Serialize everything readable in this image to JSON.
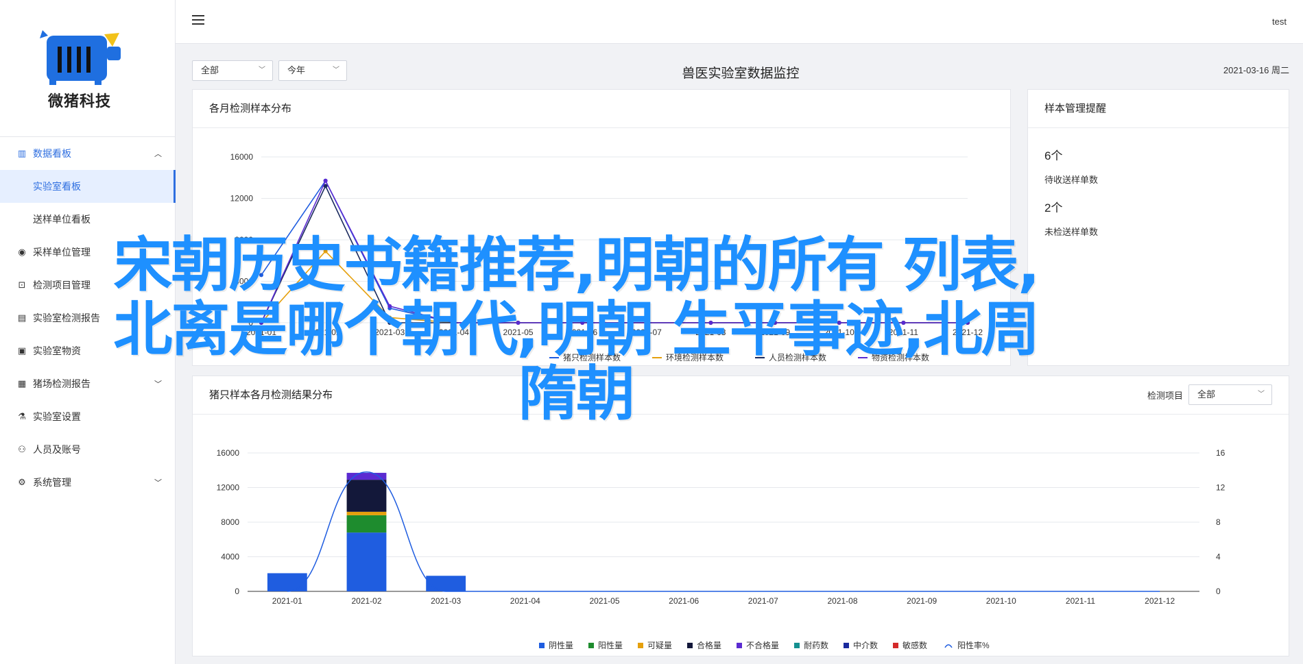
{
  "brand": {
    "name": "微猪科技"
  },
  "topbar": {
    "user": "test",
    "menu_icon": "hamburger-icon"
  },
  "sidebar": {
    "items": [
      {
        "label": "数据看板",
        "icon": "bar-chart-icon",
        "open": true,
        "children": [
          {
            "label": "实验室看板",
            "active": true
          },
          {
            "label": "送样单位看板",
            "active": false
          }
        ]
      },
      {
        "label": "采样单位管理",
        "icon": "eye-icon"
      },
      {
        "label": "检测项目管理",
        "icon": "lock-icon"
      },
      {
        "label": "实验室检测报告",
        "icon": "document-icon"
      },
      {
        "label": "实验室物资",
        "icon": "box-icon"
      },
      {
        "label": "猪场检测报告",
        "icon": "report-icon",
        "expandable": true
      },
      {
        "label": "实验室设置",
        "icon": "flask-icon"
      },
      {
        "label": "人员及账号",
        "icon": "user-icon"
      },
      {
        "label": "系统管理",
        "icon": "gear-icon",
        "expandable": true
      }
    ]
  },
  "filters": {
    "scope": "全部",
    "period": "今年"
  },
  "page": {
    "title": "兽医实验室数据监控",
    "date": "2021-03-16 周二"
  },
  "card_monthly": {
    "title": "各月检测样本分布"
  },
  "card_sample": {
    "title": "样本管理提醒",
    "stats": [
      {
        "value": "6个",
        "label": "待收送样单数"
      },
      {
        "value": "2个",
        "label": "未检送样单数"
      }
    ]
  },
  "card_pig": {
    "title": "猪只样本各月检测结果分布",
    "filter_label": "检测项目",
    "filter_value": "全部"
  },
  "overlay": {
    "lines": [
      "宋朝历史书籍推荐,明朝的所有 列表,",
      "北离是哪个朝代,明朝 生平事迹,北周",
      "隋朝"
    ]
  },
  "watermark": "",
  "chart_data": [
    {
      "type": "line",
      "title": "各月检测样本分布",
      "categories": [
        "2021-01",
        "2021-02",
        "2021-03",
        "2021-04",
        "2021-05",
        "2021-06",
        "2021-07",
        "2021-08",
        "2021-09",
        "2021-10",
        "2021-11",
        "2021-12"
      ],
      "ylim": [
        0,
        16000
      ],
      "yticks": [
        0,
        4000,
        8000,
        12000,
        16000
      ],
      "series": [
        {
          "name": "猪只检测样本数",
          "color": "#1f5de0",
          "values": [
            4600,
            13700,
            1400,
            0,
            0,
            0,
            0,
            0,
            0,
            0,
            0,
            0
          ]
        },
        {
          "name": "环境检测样本数",
          "color": "#e5a00d",
          "values": [
            0,
            6900,
            500,
            0,
            0,
            0,
            0,
            0,
            0,
            0,
            0,
            0
          ]
        },
        {
          "name": "人员检测样本数",
          "color": "#1a2a5e",
          "values": [
            0,
            13200,
            0,
            0,
            0,
            0,
            0,
            0,
            0,
            0,
            0,
            0
          ]
        },
        {
          "name": "物资检测样本数",
          "color": "#5b2bd1",
          "values": [
            0,
            13700,
            1600,
            0,
            0,
            0,
            0,
            0,
            0,
            0,
            0,
            0
          ]
        }
      ],
      "legend": "bottom"
    },
    {
      "type": "bar",
      "title": "猪只样本各月检测结果分布",
      "categories": [
        "2021-01",
        "2021-02",
        "2021-03",
        "2021-04",
        "2021-05",
        "2021-06",
        "2021-07",
        "2021-08",
        "2021-09",
        "2021-10",
        "2021-11",
        "2021-12"
      ],
      "ylim": [
        0,
        16000
      ],
      "yticks": [
        0,
        4000,
        8000,
        12000,
        16000
      ],
      "y2lim": [
        0,
        16
      ],
      "y2ticks": [
        0,
        4,
        8,
        12,
        16
      ],
      "stacked": true,
      "series": [
        {
          "name": "阴性量",
          "color": "#1f5de0",
          "values": [
            2100,
            6800,
            1800,
            0,
            0,
            0,
            0,
            0,
            0,
            0,
            0,
            0
          ]
        },
        {
          "name": "阳性量",
          "color": "#1e8c2e",
          "values": [
            0,
            2000,
            0,
            0,
            0,
            0,
            0,
            0,
            0,
            0,
            0,
            0
          ]
        },
        {
          "name": "可疑量",
          "color": "#e5a00d",
          "values": [
            0,
            400,
            0,
            0,
            0,
            0,
            0,
            0,
            0,
            0,
            0,
            0
          ]
        },
        {
          "name": "合格量",
          "color": "#13183a",
          "values": [
            0,
            3700,
            0,
            0,
            0,
            0,
            0,
            0,
            0,
            0,
            0,
            0
          ]
        },
        {
          "name": "不合格量",
          "color": "#5b2bd1",
          "values": [
            0,
            800,
            0,
            0,
            0,
            0,
            0,
            0,
            0,
            0,
            0,
            0
          ]
        },
        {
          "name": "耐药数",
          "color": "#149090",
          "values": [
            0,
            0,
            0,
            0,
            0,
            0,
            0,
            0,
            0,
            0,
            0,
            0
          ]
        },
        {
          "name": "中介数",
          "color": "#1a2a9e",
          "values": [
            0,
            0,
            0,
            0,
            0,
            0,
            0,
            0,
            0,
            0,
            0,
            0
          ]
        },
        {
          "name": "敏感数",
          "color": "#d42a2a",
          "values": [
            0,
            0,
            0,
            0,
            0,
            0,
            0,
            0,
            0,
            0,
            0,
            0
          ]
        }
      ],
      "line_series": {
        "name": "阳性率%",
        "color": "#1f5de0",
        "axis": "right",
        "values": [
          0,
          13.8,
          0,
          0,
          0,
          0,
          0,
          0,
          0,
          0,
          0,
          0
        ]
      },
      "legend": "bottom"
    }
  ]
}
